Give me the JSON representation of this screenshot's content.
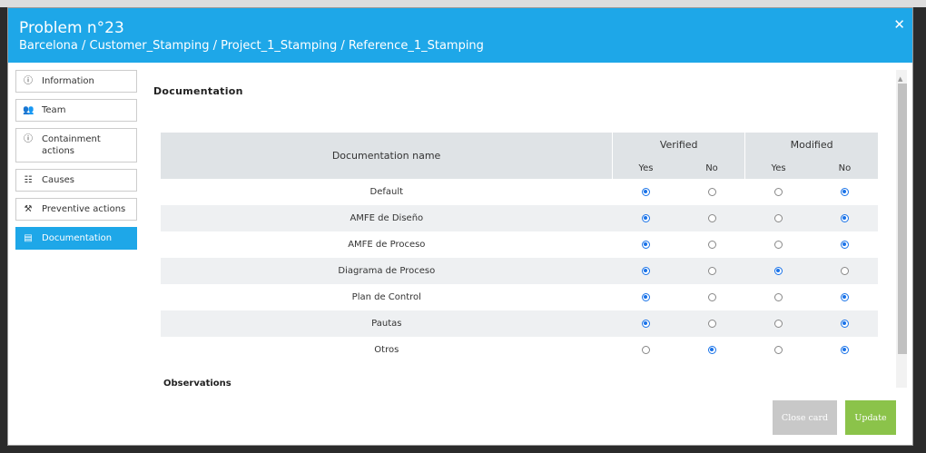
{
  "header": {
    "title": "Problem n°23",
    "breadcrumb": "Barcelona / Customer_Stamping / Project_1_Stamping / Reference_1_Stamping",
    "close_glyph": "✕",
    "color": "#1ea7e8"
  },
  "sidebar": {
    "items": [
      {
        "label": "Information",
        "icon": "info-icon",
        "glyph": "ⓘ"
      },
      {
        "label": "Team",
        "icon": "team-icon",
        "glyph": "👥"
      },
      {
        "label": "Containment actions",
        "icon": "info-icon",
        "glyph": "ⓘ"
      },
      {
        "label": "Causes",
        "icon": "hierarchy-icon",
        "glyph": "☷"
      },
      {
        "label": "Preventive actions",
        "icon": "tools-icon",
        "glyph": "⚒"
      },
      {
        "label": "Documentation",
        "icon": "document-icon",
        "glyph": "▤",
        "active": true
      }
    ]
  },
  "documentation": {
    "heading": "Documentation",
    "columns": {
      "name": "Documentation name",
      "verified": "Verified",
      "modified": "Modified",
      "yes": "Yes",
      "no": "No"
    },
    "rows": [
      {
        "name": "Default",
        "verified": "Yes",
        "modified": "No"
      },
      {
        "name": "AMFE de Diseño",
        "verified": "Yes",
        "modified": "No"
      },
      {
        "name": "AMFE de Proceso",
        "verified": "Yes",
        "modified": "No"
      },
      {
        "name": "Diagrama de Proceso",
        "verified": "Yes",
        "modified": "Yes"
      },
      {
        "name": "Plan de Control",
        "verified": "Yes",
        "modified": "No"
      },
      {
        "name": "Pautas",
        "verified": "Yes",
        "modified": "No"
      },
      {
        "name": "Otros",
        "verified": "No",
        "modified": "No"
      }
    ],
    "observations": "Observations"
  },
  "footer": {
    "close_label": "Close card",
    "update_label": "Update",
    "update_color": "#8bc34a"
  }
}
